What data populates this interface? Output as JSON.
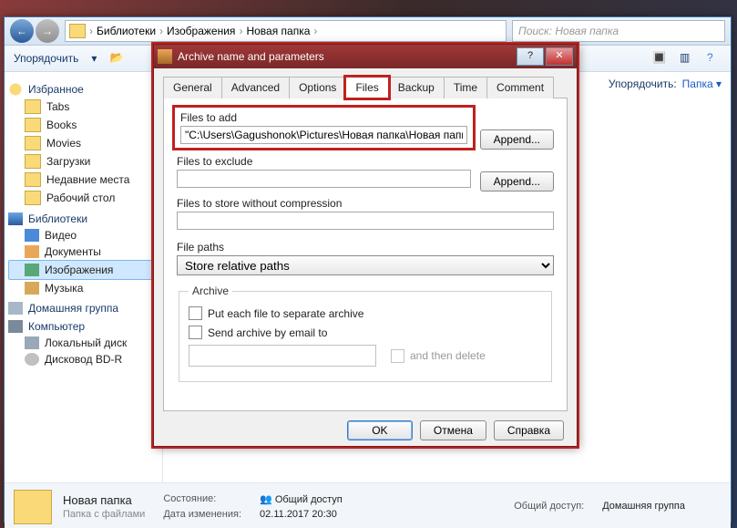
{
  "explorer": {
    "breadcrumb": [
      "Библиотеки",
      "Изображения",
      "Новая папка"
    ],
    "search_placeholder": "Поиск: Новая папка",
    "toolbar": {
      "organize": "Упорядочить"
    },
    "sidebar": {
      "favorites_title": "Избранное",
      "favorites": [
        "Tabs",
        "Books",
        "Movies",
        "Загрузки",
        "Недавние места",
        "Рабочий стол"
      ],
      "libraries_title": "Библиотеки",
      "libraries": [
        "Видео",
        "Документы",
        "Изображения",
        "Музыка"
      ],
      "homegroup": "Домашняя группа",
      "computer": "Компьютер",
      "computer_items": [
        "Локальный диск",
        "Дисковод BD-R"
      ]
    },
    "sort": {
      "label": "Упорядочить:",
      "value": "Папка"
    },
    "status": {
      "name": "Новая папка",
      "type": "Папка с файлами",
      "state_label": "Состояние:",
      "state_value": "Общий доступ",
      "access_label": "Общий доступ:",
      "access_value": "Домашняя группа",
      "modified_label": "Дата изменения:",
      "modified_value": "02.11.2017 20:30"
    }
  },
  "dialog": {
    "title": "Archive name and parameters",
    "tabs": [
      "General",
      "Advanced",
      "Options",
      "Files",
      "Backup",
      "Time",
      "Comment"
    ],
    "active_tab": "Files",
    "files_to_add_label": "Files to add",
    "files_to_add_value": "\"C:\\Users\\Gagushonok\\Pictures\\Новая папка\\Новая папка\"",
    "files_to_exclude_label": "Files to exclude",
    "files_to_exclude_value": "",
    "files_no_compress_label": "Files to store without compression",
    "files_no_compress_value": "",
    "file_paths_label": "File paths",
    "file_paths_value": "Store relative paths",
    "append": "Append...",
    "archive_group": "Archive",
    "put_separate": "Put each file to separate archive",
    "send_email": "Send archive by email to",
    "and_then_delete": "and then delete",
    "ok": "OK",
    "cancel": "Отмена",
    "help": "Справка"
  }
}
